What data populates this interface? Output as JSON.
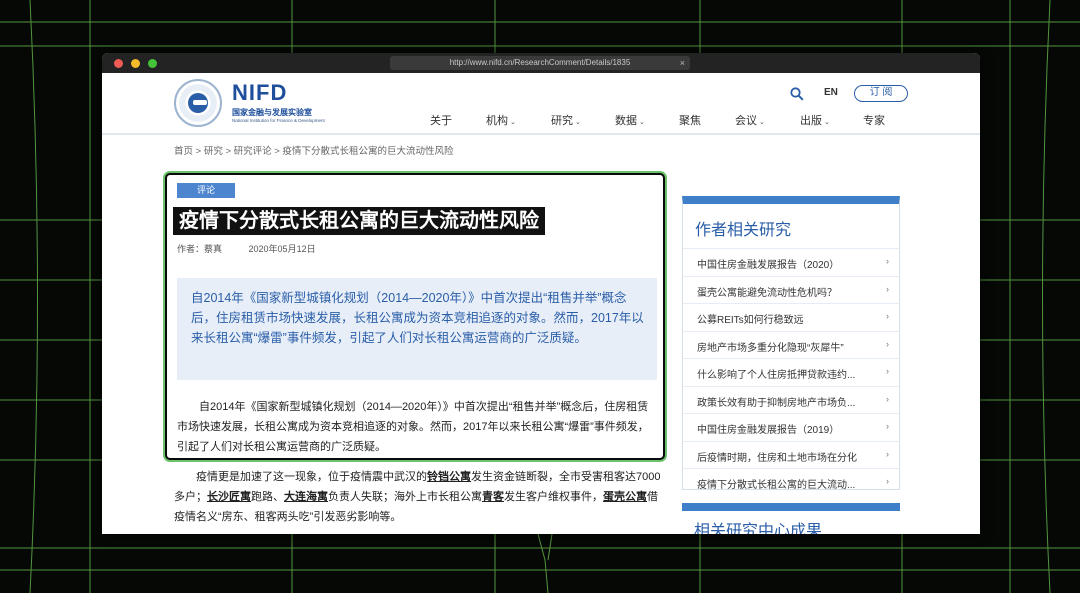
{
  "browser": {
    "url": "http://www.nifd.cn/ResearchComment/Details/1835",
    "close_glyph": "×"
  },
  "header": {
    "logo_name": "NIFD",
    "logo_cn": "国家金融与发展实验室",
    "logo_en": "National Institution for Finance & Development",
    "lang": "EN",
    "subscribe": "订 阅",
    "nav": [
      {
        "label": "关于",
        "chevron": false
      },
      {
        "label": "机构",
        "chevron": true
      },
      {
        "label": "研究",
        "chevron": true
      },
      {
        "label": "数据",
        "chevron": true
      },
      {
        "label": "聚焦",
        "chevron": false
      },
      {
        "label": "会议",
        "chevron": true
      },
      {
        "label": "出版",
        "chevron": true
      },
      {
        "label": "专家",
        "chevron": false
      }
    ]
  },
  "breadcrumb": "首页 > 研究 > 研究评论 > 疫情下分散式长租公寓的巨大流动性风险",
  "article": {
    "tag": "评论",
    "title": "疫情下分散式长租公寓的巨大流动性风险",
    "author": "作者：蔡真",
    "date": "2020年05月12日",
    "summary": "自2014年《国家新型城镇化规划（2014—2020年）》中首次提出“租售并举”概念后，住房租赁市场快速发展，长租公寓成为资本竞相追逐的对象。然而，2017年以来长租公寓“爆雷”事件频发，引起了人们对长租公寓运营商的广泛质疑。",
    "body": "自2014年《国家新型城镇化规划（2014—2020年）》中首次提出“租售并举”概念后，住房租赁市场快速发展，长租公寓成为资本竞相追逐的对象。然而，2017年以来长租公寓“爆雷”事件频发，引起了人们对长租公寓运营商的广泛质疑。",
    "after_parts": [
      {
        "text": "疫情更是加速了这一现象，位于疫情震中武汉的",
        "bold": false
      },
      {
        "text": "铃铛公寓",
        "bold": true
      },
      {
        "text": "发生资金链断裂，全市受害租客达7000多户；",
        "bold": false
      },
      {
        "text": "长沙匠寓",
        "bold": true
      },
      {
        "text": "跑路、",
        "bold": false
      },
      {
        "text": "大连海寓",
        "bold": true
      },
      {
        "text": "负责人失联；海外上市长租公寓",
        "bold": false
      },
      {
        "text": "青客",
        "bold": true
      },
      {
        "text": "发生客户维权事件，",
        "bold": false
      },
      {
        "text": "蛋壳公寓",
        "bold": true
      },
      {
        "text": "借疫情名义“房东、租客两头吃”引发恶劣影响等。",
        "bold": false
      }
    ]
  },
  "sidebar": {
    "title": "作者相关研究",
    "items": [
      "中国住房金融发展报告（2020）",
      "蛋壳公寓能避免流动性危机吗？",
      "公募REITs如何行稳致远",
      "房地产市场多重分化隐现“灰犀牛”",
      "什么影响了个人住房抵押贷款违约...",
      "政策长效有助于抑制房地产市场负...",
      "中国住房金融发展报告（2019）",
      "后疫情时期，住房和土地市场在分化",
      "疫情下分散式长租公寓的巨大流动..."
    ],
    "arrow": "›",
    "second_title": "相关研究中心成果"
  },
  "colors": {
    "accent": "#2a5ea8",
    "highlight_border": "#6ac26a",
    "summary_bg": "#e8eef8"
  }
}
